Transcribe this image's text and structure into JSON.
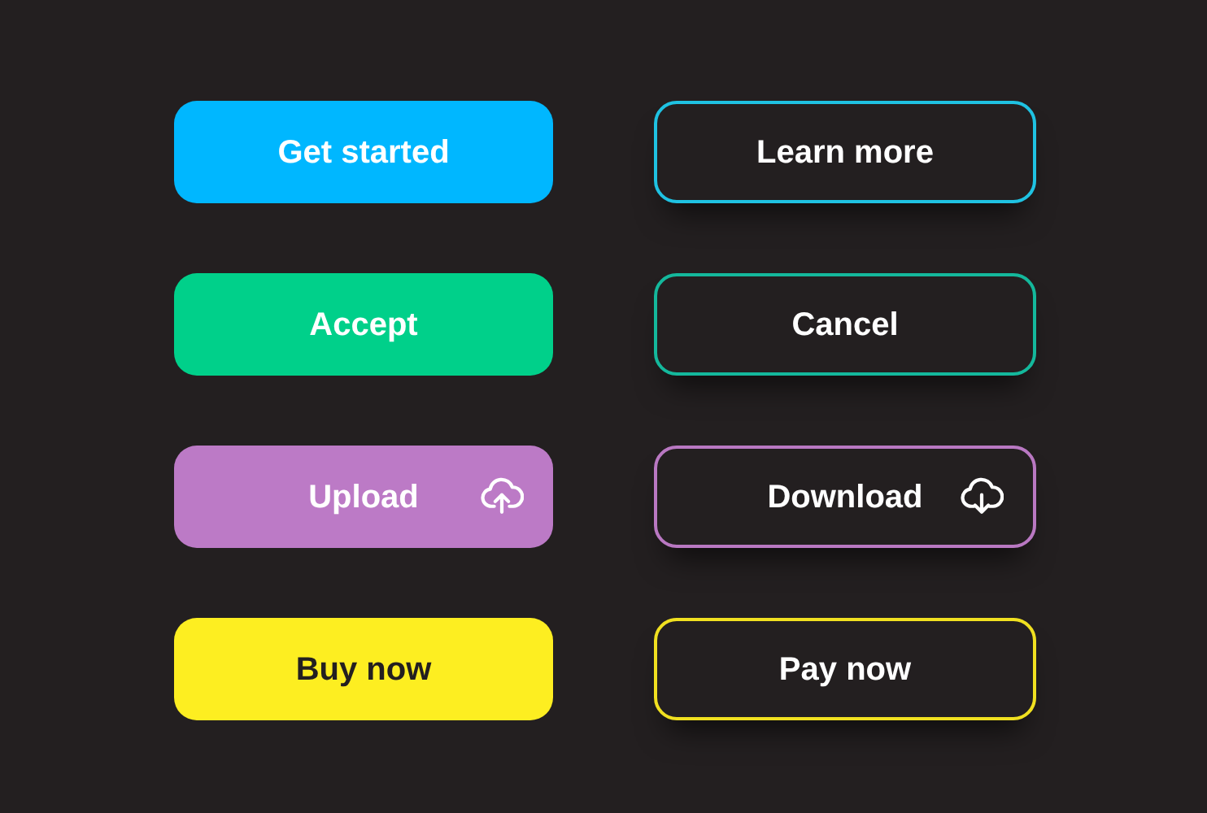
{
  "buttons": [
    {
      "label": "Get started",
      "kind": "filled",
      "color": "#00b7ff"
    },
    {
      "label": "Learn more",
      "kind": "outline",
      "color": "#1fc2e2"
    },
    {
      "label": "Accept",
      "kind": "filled",
      "color": "#00d08a"
    },
    {
      "label": "Cancel",
      "kind": "outline",
      "color": "#14b89c"
    },
    {
      "label": "Upload",
      "kind": "upload",
      "color": "#bc7ac6"
    },
    {
      "label": "Download",
      "kind": "download",
      "color": "#b978c2"
    },
    {
      "label": "Buy now",
      "kind": "filled",
      "color": "#fdee21"
    },
    {
      "label": "Pay now",
      "kind": "outline",
      "color": "#f0e020"
    }
  ]
}
